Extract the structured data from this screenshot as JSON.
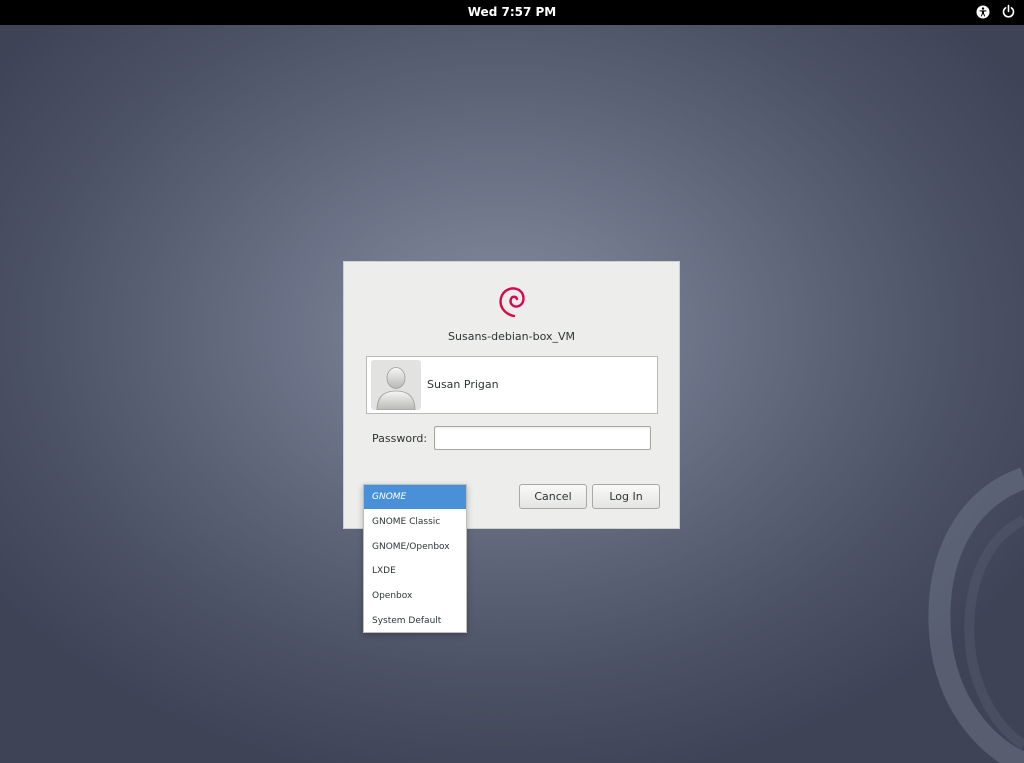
{
  "top_bar": {
    "clock": "Wed  7:57 PM",
    "icons": [
      "accessibility-icon",
      "power-icon"
    ]
  },
  "dialog": {
    "hostname": "Susans-debian-box_VM",
    "user": {
      "name": "Susan Prigan"
    },
    "password": {
      "label": "Password:",
      "value": "",
      "placeholder": ""
    },
    "buttons": {
      "cancel": "Cancel",
      "login": "Log In"
    }
  },
  "session_menu": {
    "selected": "GNOME",
    "items": [
      "GNOME",
      "GNOME Classic",
      "GNOME/Openbox",
      "LXDE",
      "Openbox",
      "System Default"
    ]
  },
  "colors": {
    "topbar": "#000000",
    "dialog_bg": "#ededeb",
    "menu_selected": "#4a90d9",
    "debian_red": "#d70751"
  }
}
